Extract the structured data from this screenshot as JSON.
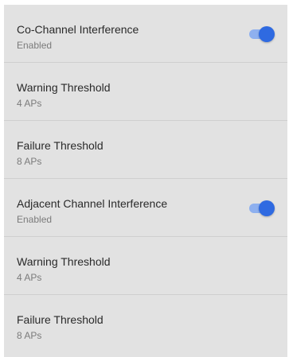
{
  "settings": {
    "co_channel": {
      "title": "Co-Channel Interference",
      "status": "Enabled",
      "enabled": true
    },
    "co_warning": {
      "title": "Warning Threshold",
      "value": "4 APs"
    },
    "co_failure": {
      "title": "Failure Threshold",
      "value": "8 APs"
    },
    "adjacent_channel": {
      "title": "Adjacent Channel Interference",
      "status": "Enabled",
      "enabled": true
    },
    "adj_warning": {
      "title": "Warning Threshold",
      "value": "4 APs"
    },
    "adj_failure": {
      "title": "Failure Threshold",
      "value": "8 APs"
    }
  },
  "colors": {
    "toggle_on": "#2f6ae1",
    "toggle_track": "#8eb0ef",
    "panel_bg": "#e2e2e2"
  }
}
